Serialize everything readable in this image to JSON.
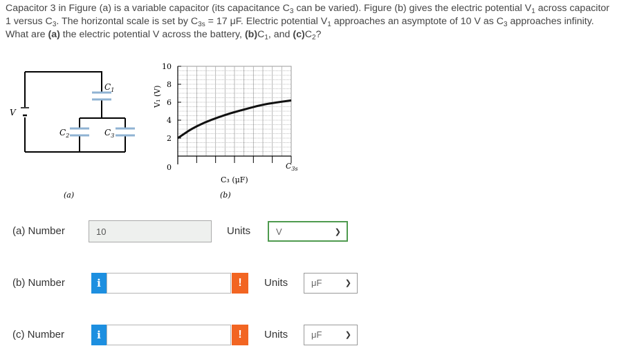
{
  "question": {
    "p1": "Capacitor 3 in Figure (a) is a variable capacitor (its capacitance C",
    "p1_sub": "3",
    "p2": " can be varied). Figure (b) gives the electric potential V",
    "p2_sub": "1",
    "p3": " across capacitor 1 versus C",
    "p3_sub": "3",
    "p4": ". The horizontal scale is set by C",
    "p4_sub": "3s",
    "p5": " = 17 μF. Electric potential V",
    "p5_sub": "1",
    "p6": " approaches an asymptote of 10 V as C",
    "p6_sub": "3",
    "p7": " approaches infinity. What are ",
    "p7_bold": "(a)",
    "p8": " the electric potential V across the battery, ",
    "p8_bold": "(b)",
    "p9": "C",
    "p9_sub": "1",
    "p10": ", and ",
    "p10_bold": "(c)",
    "p11": "C",
    "p11_sub": "2",
    "p12": "?"
  },
  "figure_a": {
    "caption": "(a)",
    "label_v": "V",
    "label_c1": "C",
    "label_c1_sub": "1",
    "label_c2": "C",
    "label_c2_sub": "2",
    "label_c3": "C",
    "label_c3_sub": "3"
  },
  "figure_b": {
    "caption": "(b)",
    "y_ticks": [
      "10",
      "8",
      "6",
      "4",
      "2",
      "0"
    ],
    "y_label": "V₁ (V)",
    "x_label": "C₃ (μF)",
    "x_end_label": "C",
    "x_end_sub": "3s"
  },
  "chart_data": {
    "type": "line",
    "title": "",
    "xlabel": "C3 (μF)",
    "ylabel": "V1 (V)",
    "ylim": [
      0,
      10
    ],
    "xlim": [
      0,
      17
    ],
    "x": [
      0,
      1,
      2,
      4,
      6,
      8,
      10,
      12,
      14,
      17
    ],
    "series": [
      {
        "values": [
          2.0,
          2.5,
          3.0,
          3.75,
          4.3,
          4.8,
          5.2,
          5.6,
          5.9,
          6.2
        ]
      }
    ],
    "grid": true
  },
  "answers": [
    {
      "label": "(a)   Number",
      "value": "10",
      "units_label": "Units",
      "unit": "V"
    },
    {
      "label": "(b)   Number",
      "value": "",
      "units_label": "Units",
      "unit": "μF",
      "info": "i",
      "warn": "!"
    },
    {
      "label": "(c)   Number",
      "value": "",
      "units_label": "Units",
      "unit": "μF",
      "info": "i",
      "warn": "!"
    }
  ],
  "icons": {
    "info": "info-icon",
    "warn": "warning-icon",
    "chevron": "chevron-down-icon"
  },
  "colors": {
    "info": "#1d8fe0",
    "warn": "#f26522",
    "correct_border": "#4e9a4e"
  }
}
